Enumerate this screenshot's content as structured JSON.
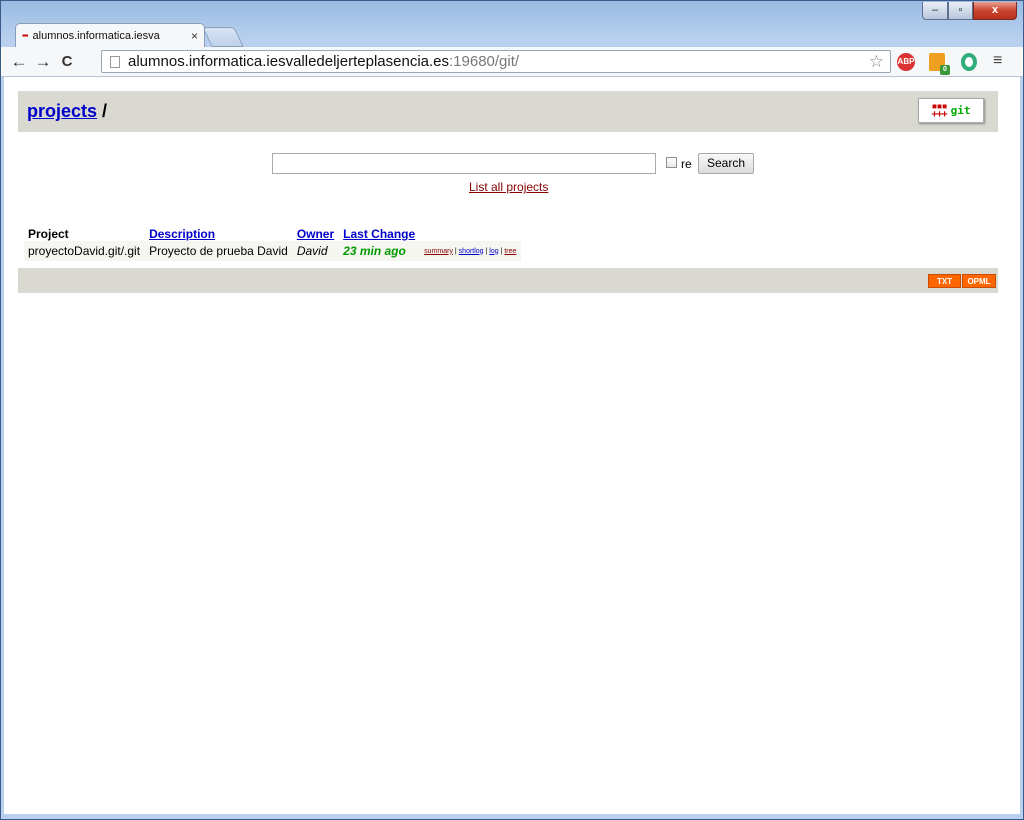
{
  "browser": {
    "tab_title": "alumnos.informatica.iesva",
    "tab_close": "×",
    "url_host": "alumnos.informatica.iesvalledeljerteplasencia.es",
    "url_path": ":19680/git/",
    "back": "←",
    "forward": "→",
    "reload": "C",
    "star": "☆",
    "menu": "≡",
    "ext_abp": "ABP",
    "ext_badge": "0",
    "window_min": "–",
    "window_max": "▫",
    "window_close": "x"
  },
  "header": {
    "breadcrumb_link": "projects",
    "breadcrumb_sep": "/",
    "logo_dots": "▪▪▪\n+++",
    "logo_text": "git"
  },
  "search": {
    "value": "",
    "re_label": "re",
    "button": "Search",
    "list_all": "List all projects"
  },
  "table": {
    "columns": {
      "project": "Project",
      "description": "Description",
      "owner": "Owner",
      "last_change": "Last Change"
    },
    "rows": [
      {
        "project": "proyectoDavid.git/.git",
        "description": "Proyecto de prueba David",
        "owner": "David",
        "age": "23 min ago",
        "links": {
          "summary": "summary",
          "shortlog": "shortlog",
          "log": "log",
          "tree": "tree",
          "sep": " | "
        }
      }
    ]
  },
  "footer": {
    "txt": "TXT",
    "opml": "OPML"
  }
}
